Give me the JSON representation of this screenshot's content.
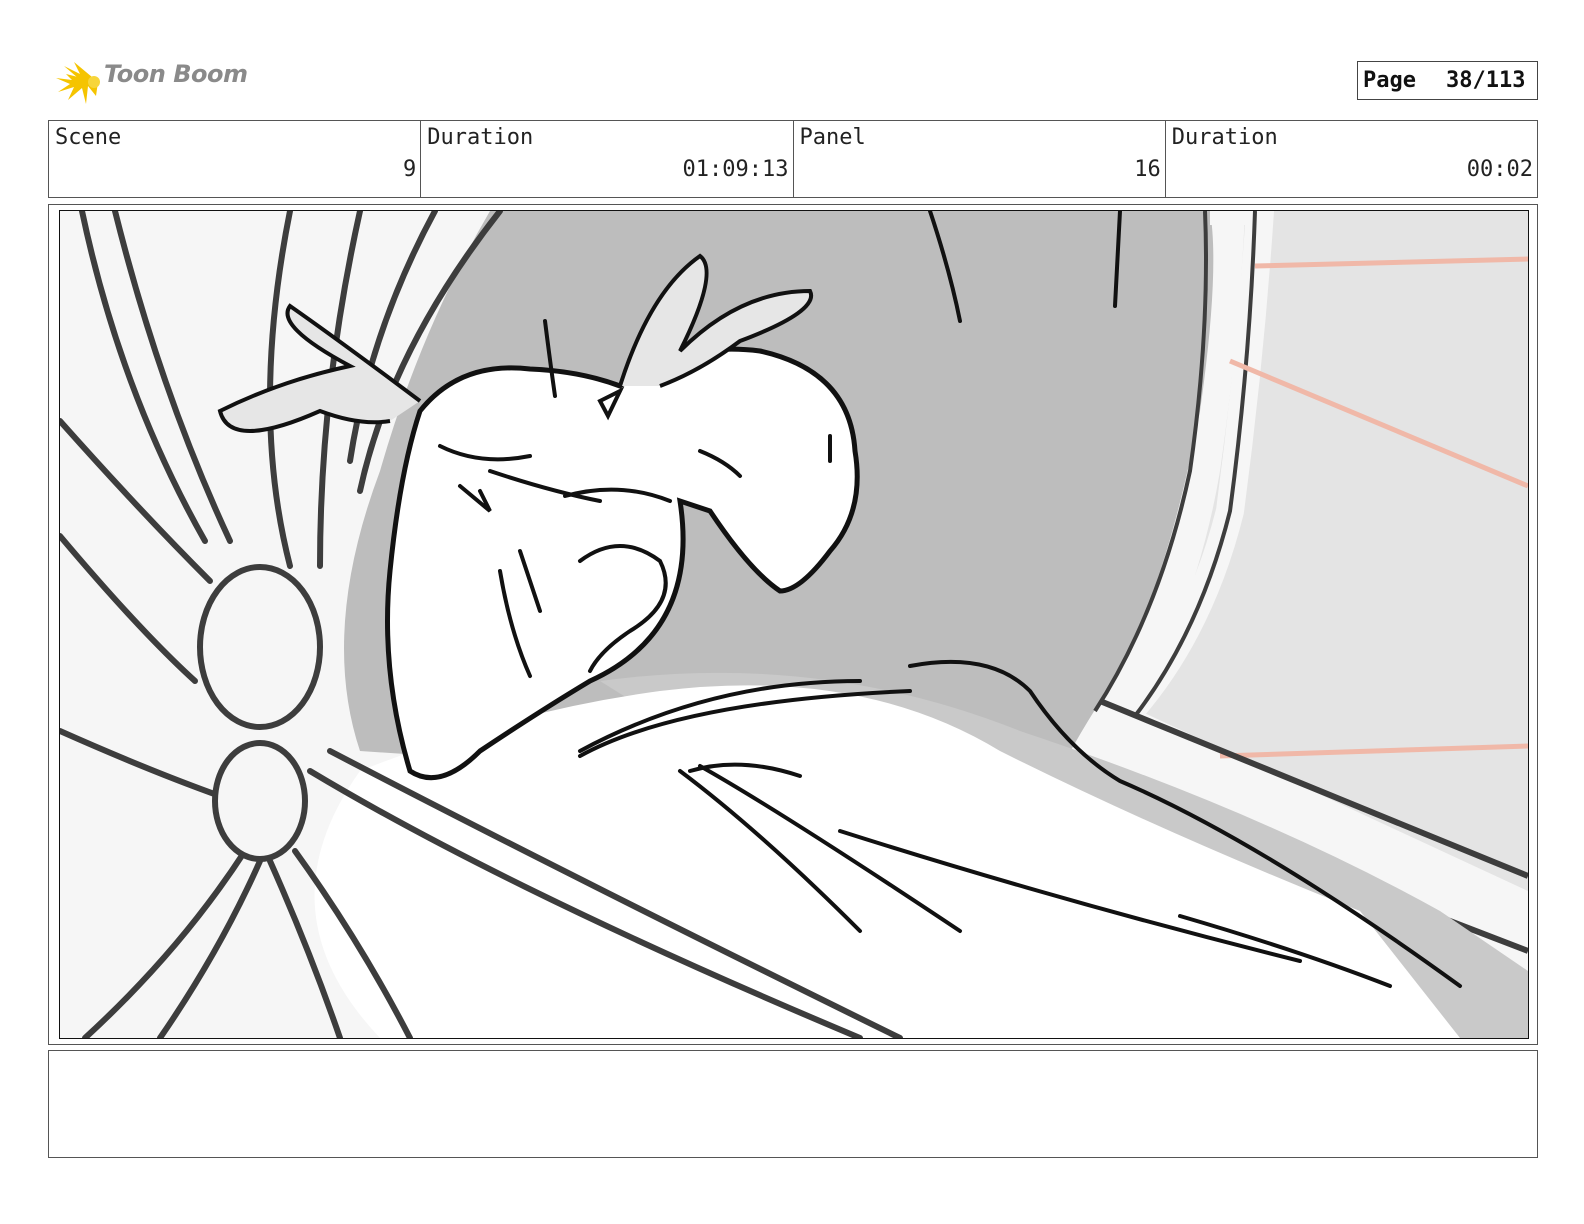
{
  "header": {
    "logo_text": "Toon Boom",
    "page_label": "Page",
    "page_value": "38/113"
  },
  "info": {
    "scene_label": "Scene",
    "scene_value": "9",
    "scene_duration_label": "Duration",
    "scene_duration_value": "01:09:13",
    "panel_label": "Panel",
    "panel_value": "16",
    "panel_duration_label": "Duration",
    "panel_duration_value": "00:02"
  },
  "notes": {
    "text": ""
  },
  "colors": {
    "logo_yellow": "#f5c400",
    "logo_text": "#8a8a8a",
    "line_red": "#f0b8a8",
    "tone_dark": "#bdbdbd",
    "tone_light": "#e4e4e4"
  }
}
